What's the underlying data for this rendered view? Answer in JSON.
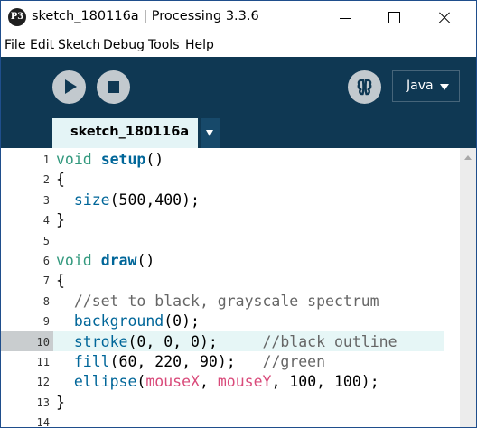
{
  "window": {
    "title": "sketch_180116a | Processing 3.3.6",
    "app_icon_glyph": "P3"
  },
  "menu": [
    "File",
    "Edit",
    "Sketch",
    "Debug",
    "Tools",
    "Help"
  ],
  "toolbar": {
    "run_icon": "play-icon",
    "stop_icon": "stop-icon",
    "debug_icon": "butterfly-debugger-icon",
    "mode": "Java"
  },
  "tabs": [
    {
      "label": "sketch_180116a",
      "active": true
    }
  ],
  "editor": {
    "highlighted_line": 10,
    "lines": [
      {
        "n": "1",
        "t": [
          {
            "s": "void",
            "k": "k"
          },
          {
            "s": " ",
            "k": ""
          },
          {
            "s": "setup",
            "k": "f"
          },
          {
            "s": "()",
            "k": ""
          }
        ]
      },
      {
        "n": "2",
        "t": [
          {
            "s": "{",
            "k": ""
          }
        ]
      },
      {
        "n": "3",
        "t": [
          {
            "s": "  ",
            "k": ""
          },
          {
            "s": "size",
            "k": "b"
          },
          {
            "s": "(500,400);",
            "k": ""
          }
        ]
      },
      {
        "n": "4",
        "t": [
          {
            "s": "}",
            "k": ""
          }
        ]
      },
      {
        "n": "5",
        "t": []
      },
      {
        "n": "6",
        "t": [
          {
            "s": "void",
            "k": "k"
          },
          {
            "s": " ",
            "k": ""
          },
          {
            "s": "draw",
            "k": "f"
          },
          {
            "s": "()",
            "k": ""
          }
        ]
      },
      {
        "n": "7",
        "t": [
          {
            "s": "{",
            "k": ""
          }
        ]
      },
      {
        "n": "8",
        "t": [
          {
            "s": "  //set to black, grayscale spectrum",
            "k": "c"
          }
        ]
      },
      {
        "n": "9",
        "t": [
          {
            "s": "  ",
            "k": ""
          },
          {
            "s": "background",
            "k": "b"
          },
          {
            "s": "(0);",
            "k": ""
          }
        ]
      },
      {
        "n": "10",
        "t": [
          {
            "s": "  ",
            "k": ""
          },
          {
            "s": "stroke",
            "k": "b"
          },
          {
            "s": "(0, 0, 0);     ",
            "k": ""
          },
          {
            "s": "//black outline",
            "k": "c"
          }
        ]
      },
      {
        "n": "11",
        "t": [
          {
            "s": "  ",
            "k": ""
          },
          {
            "s": "fill",
            "k": "b"
          },
          {
            "s": "(60, 220, 90);   ",
            "k": ""
          },
          {
            "s": "//green",
            "k": "c"
          }
        ]
      },
      {
        "n": "12",
        "t": [
          {
            "s": "  ",
            "k": ""
          },
          {
            "s": "ellipse",
            "k": "b"
          },
          {
            "s": "(",
            "k": ""
          },
          {
            "s": "mouseX",
            "k": "v"
          },
          {
            "s": ", ",
            "k": ""
          },
          {
            "s": "mouseY",
            "k": "v"
          },
          {
            "s": ", 100, 100);",
            "k": ""
          }
        ]
      },
      {
        "n": "13",
        "t": [
          {
            "s": "}",
            "k": ""
          }
        ]
      },
      {
        "n": "14",
        "t": []
      }
    ]
  },
  "colors": {
    "toolbar_bg": "#0f3853",
    "tab_active_bg": "#e4f4f6",
    "keyword": "#33997e",
    "function": "#006699",
    "comment": "#666666",
    "variable": "#d94a7a"
  }
}
